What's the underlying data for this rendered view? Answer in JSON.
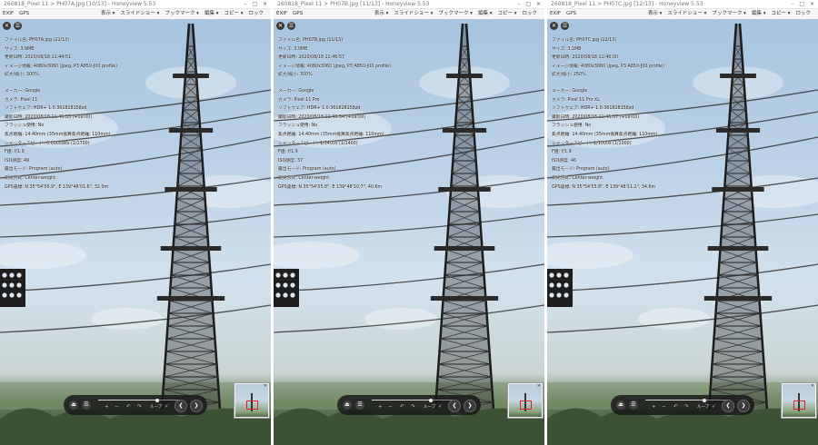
{
  "windows": [
    {
      "title": "260818_Pixel 11 > PH07A.jpg [10/13] - Honeyview 5.53",
      "toolbar_left": [
        "EXIF",
        "GPS"
      ],
      "toolbar_right": [
        "表示 ▾",
        "スライドショー ▾",
        "ブックマーク ▾",
        "編集 ▾",
        "コピー ▾",
        "ロック"
      ],
      "window_controls": "– □ ✕",
      "exif_info": [
        "ファイル名: PH07A.jpg (22/13)",
        "サイズ: 3.9MB",
        "更新日時: 2020/08/18 11:44:51",
        "イメージ情報: 4080x3060 (Jpeg, P3 A850-J00 profile)",
        "拡大/縮小: 300%",
        "メーカー: Google",
        "カメラ: Pixel 11",
        "ソフトウェア: HDR+ 1.0.361828158zd",
        "撮影日時: 2020/08/18 11:46:55 (+09:00)",
        "フラッシュ使用: No",
        "焦点距離: 14.40mm (35mm換算焦点距離: 110mm)",
        "シャッタースピード: 0.000588s (1/1700)",
        "F値: f/1.9",
        "ISO感度: 49",
        "露出モード: Program (auto)",
        "測光方式: Center-weight",
        "GPS座標: N 35°54'56.9\", E 139°48'01.6\", 32.0m"
      ],
      "controls": {
        "eject_icon": "⏏",
        "menu_icon": "☰",
        "plus": "+",
        "minus": "−",
        "rotate_left": "↶",
        "rotate_right": "↷",
        "loop_label": "ループ",
        "check": "✓",
        "prev_icon": "❮",
        "next_icon": "❯"
      },
      "slider_position": 0.72,
      "thumb_close": "✕"
    },
    {
      "title": "260818_Pixel 11 > PH07B.jpg [11/13] - Honeyview 5.53",
      "toolbar_left": [
        "EXIF",
        "GPS"
      ],
      "toolbar_right": [
        "表示 ▾",
        "スライドショー ▾",
        "ブックマーク ▾",
        "編集 ▾",
        "コピー ▾",
        "ロック"
      ],
      "window_controls": "– □ ✕",
      "exif_info": [
        "ファイル名: PH07B.jpg (11/13)",
        "サイズ: 3.0MB",
        "更新日時: 2020/08/18 11:46:57",
        "イメージ情報: 4080x3060 (Jpeg, P3 A850-J00 profile)",
        "拡大/縮小: 300%",
        "メーカー: Google",
        "カメラ: Pixel 11 Pro",
        "ソフトウェア: HDR+ 1.0.361828158zd",
        "撮影日時: 2020/08/18 11:46:54 (+09:00)",
        "フラッシュ使用: No",
        "焦点距離: 14.40mm (35mm換算焦点距離: 110mm)",
        "シャッタースピード: 1/1400s (1/1400)",
        "F値: f/1.9",
        "ISO感度: 37",
        "露出モード: Program (auto)",
        "測光方式: Center-weight",
        "GPS座標: N 35°54'55.8\", E 139°48'10.7\", 40.6m"
      ],
      "controls": {
        "eject_icon": "⏏",
        "menu_icon": "☰",
        "plus": "+",
        "minus": "−",
        "rotate_left": "↶",
        "rotate_right": "↷",
        "loop_label": "ループ",
        "check": "✓",
        "prev_icon": "❮",
        "next_icon": "❯"
      },
      "slider_position": 0.72,
      "thumb_close": "✕"
    },
    {
      "title": "260818_Pixel 11 > PH07C.jpg [12/13] - Honeyview 5.53",
      "toolbar_left": [
        "EXIF",
        "GPS"
      ],
      "toolbar_right": [
        "表示 ▾",
        "スライドショー ▾",
        "ブックマーク ▾",
        "編集 ▾",
        "コピー ▾",
        "ロック"
      ],
      "window_controls": "– □ ✕",
      "exif_info": [
        "ファイル名: PH07C.jpg (12/13)",
        "サイズ: 3.1MB",
        "更新日時: 2020/08/18 11:46:00",
        "イメージ情報: 4080x3060 (Jpeg, P3 A850-J00 profile)",
        "拡大/縮小: 250%",
        "メーカー: Google",
        "カメラ: Pixel 11 Pro XL",
        "ソフトウェア: HDR+ 1.0.361828158zd",
        "撮影日時: 2020/08/18 11:46:57 (+09:00)",
        "フラッシュ使用: No",
        "焦点距離: 14.40mm (35mm換算焦点距離: 110mm)",
        "シャッタースピード: 1/1000s (1/1000)",
        "F値: f/1.9",
        "ISO感度: 46",
        "露出モード: Program (auto)",
        "測光方式: Center-weight",
        "GPS座標: N 35°54'55.8\", E 139°48'11.2\", 34.6m"
      ],
      "controls": {
        "eject_icon": "⏏",
        "menu_icon": "☰",
        "plus": "+",
        "minus": "−",
        "rotate_left": "↶",
        "rotate_right": "↷",
        "loop_label": "ループ",
        "check": "✓",
        "prev_icon": "❮",
        "next_icon": "❯"
      },
      "slider_position": 0.72,
      "thumb_close": "✕"
    }
  ],
  "overlay_icons": {
    "close": "✕",
    "menu": "☰"
  }
}
